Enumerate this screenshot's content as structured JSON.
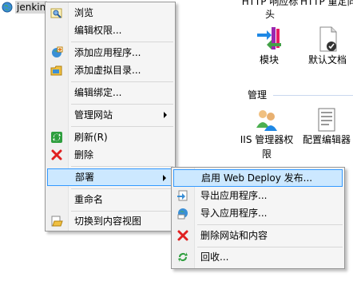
{
  "tree": {
    "site_label": "jenkin"
  },
  "right_pane": {
    "header_left": "HTTP 响应标头",
    "header_right": "HTTP 重定向",
    "features_top": [
      {
        "label": "模块",
        "icon": "modules-icon"
      },
      {
        "label": "默认文档",
        "icon": "default-document-icon"
      }
    ],
    "section_title": "管理",
    "features_bottom": [
      {
        "label": "IIS 管理器权限",
        "icon": "iis-manager-permissions-icon"
      },
      {
        "label": "配置编辑器",
        "icon": "configuration-editor-icon"
      }
    ]
  },
  "context_menu": {
    "items": [
      {
        "label": "浏览",
        "icon": "browse-icon"
      },
      {
        "label": "编辑权限...",
        "icon": ""
      },
      {
        "label": "添加应用程序...",
        "icon": "add-application-icon"
      },
      {
        "label": "添加虚拟目录...",
        "icon": "add-virtual-directory-icon"
      },
      {
        "label": "编辑绑定...",
        "icon": ""
      },
      {
        "label": "管理网站",
        "icon": ""
      },
      {
        "label": "刷新(R)",
        "icon": "refresh-icon"
      },
      {
        "label": "删除",
        "icon": "delete-icon"
      },
      {
        "label": "部署",
        "icon": ""
      },
      {
        "label": "重命名",
        "icon": ""
      },
      {
        "label": "切换到内容视图",
        "icon": "content-view-icon"
      }
    ]
  },
  "deploy_submenu": {
    "items": [
      {
        "label": "启用 Web Deploy 发布...",
        "icon": ""
      },
      {
        "label": "导出应用程序...",
        "icon": "export-application-icon"
      },
      {
        "label": "导入应用程序...",
        "icon": "import-application-icon"
      },
      {
        "label": "删除网站和内容",
        "icon": "delete-site-icon"
      },
      {
        "label": "回收...",
        "icon": "recycle-icon"
      }
    ]
  },
  "colors": {
    "highlight_bg": "#cce8ff",
    "highlight_border": "#3399ff",
    "menu_bg": "#f5f5f5",
    "delete_red": "#e02020"
  }
}
